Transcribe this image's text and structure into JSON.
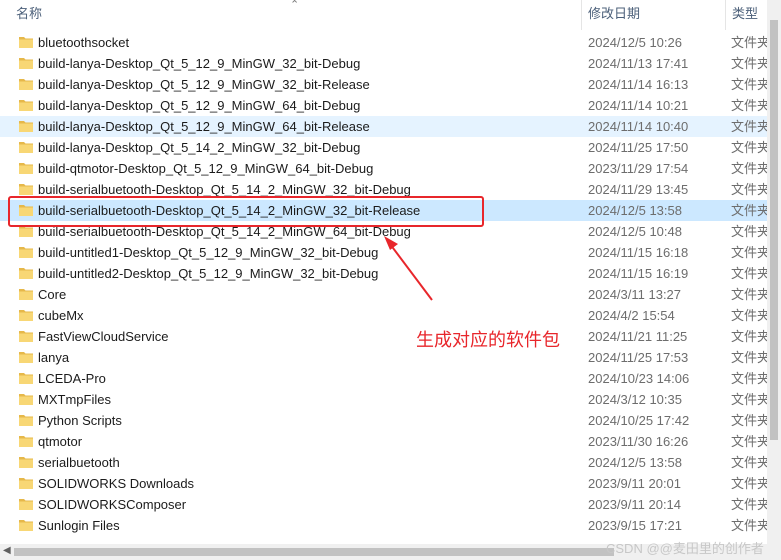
{
  "header": {
    "name": "名称",
    "date": "修改日期",
    "type": "类型"
  },
  "rows": [
    {
      "name": "bluetoothsocket",
      "date": "2024/12/5 10:26",
      "type": "文件夹"
    },
    {
      "name": "build-lanya-Desktop_Qt_5_12_9_MinGW_32_bit-Debug",
      "date": "2024/11/13 17:41",
      "type": "文件夹"
    },
    {
      "name": "build-lanya-Desktop_Qt_5_12_9_MinGW_32_bit-Release",
      "date": "2024/11/14 16:13",
      "type": "文件夹"
    },
    {
      "name": "build-lanya-Desktop_Qt_5_12_9_MinGW_64_bit-Debug",
      "date": "2024/11/14 10:21",
      "type": "文件夹"
    },
    {
      "name": "build-lanya-Desktop_Qt_5_12_9_MinGW_64_bit-Release",
      "date": "2024/11/14 10:40",
      "type": "文件夹"
    },
    {
      "name": "build-lanya-Desktop_Qt_5_14_2_MinGW_32_bit-Debug",
      "date": "2024/11/25 17:50",
      "type": "文件夹"
    },
    {
      "name": "build-qtmotor-Desktop_Qt_5_12_9_MinGW_64_bit-Debug",
      "date": "2023/11/29 17:54",
      "type": "文件夹"
    },
    {
      "name": "build-serialbuetooth-Desktop_Qt_5_14_2_MinGW_32_bit-Debug",
      "date": "2024/11/29 13:45",
      "type": "文件夹"
    },
    {
      "name": "build-serialbuetooth-Desktop_Qt_5_14_2_MinGW_32_bit-Release",
      "date": "2024/12/5 13:58",
      "type": "文件夹"
    },
    {
      "name": "build-serialbuetooth-Desktop_Qt_5_14_2_MinGW_64_bit-Debug",
      "date": "2024/12/5 10:48",
      "type": "文件夹"
    },
    {
      "name": "build-untitled1-Desktop_Qt_5_12_9_MinGW_32_bit-Debug",
      "date": "2024/11/15 16:18",
      "type": "文件夹"
    },
    {
      "name": "build-untitled2-Desktop_Qt_5_12_9_MinGW_32_bit-Debug",
      "date": "2024/11/15 16:19",
      "type": "文件夹"
    },
    {
      "name": "Core",
      "date": "2024/3/11 13:27",
      "type": "文件夹"
    },
    {
      "name": "cubeMx",
      "date": "2024/4/2 15:54",
      "type": "文件夹"
    },
    {
      "name": "FastViewCloudService",
      "date": "2024/11/21 11:25",
      "type": "文件夹"
    },
    {
      "name": "lanya",
      "date": "2024/11/25 17:53",
      "type": "文件夹"
    },
    {
      "name": "LCEDA-Pro",
      "date": "2024/10/23 14:06",
      "type": "文件夹"
    },
    {
      "name": "MXTmpFiles",
      "date": "2024/3/12 10:35",
      "type": "文件夹"
    },
    {
      "name": "Python Scripts",
      "date": "2024/10/25 17:42",
      "type": "文件夹"
    },
    {
      "name": "qtmotor",
      "date": "2023/11/30 16:26",
      "type": "文件夹"
    },
    {
      "name": "serialbuetooth",
      "date": "2024/12/5 13:58",
      "type": "文件夹"
    },
    {
      "name": "SOLIDWORKS Downloads",
      "date": "2023/9/11 20:01",
      "type": "文件夹"
    },
    {
      "name": "SOLIDWORKSComposer",
      "date": "2023/9/11 20:14",
      "type": "文件夹"
    },
    {
      "name": "Sunlogin Files",
      "date": "2023/9/15 17:21",
      "type": "文件夹"
    }
  ],
  "annotation": "生成对应的软件包",
  "watermark": "CSDN @@麦田里的创作者",
  "colors": {
    "folder": "#f8d775",
    "selected": "#cce8ff",
    "hover": "#e5f3ff",
    "annotation": "#e8262b"
  }
}
